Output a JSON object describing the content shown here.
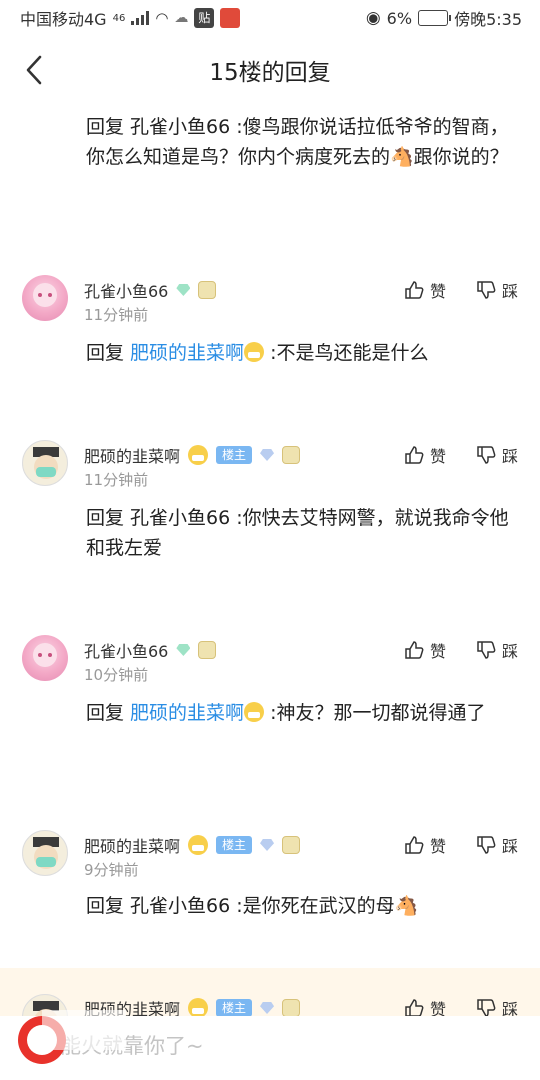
{
  "status": {
    "carrier": "中国移动4G",
    "net": "46",
    "battery": "6%",
    "time": "傍晚5:35",
    "badge1": "贴"
  },
  "nav": {
    "title": "15楼的回复"
  },
  "main_reply": {
    "text": "回复 孔雀小鱼66 :傻鸟跟你说话拉低爷爷的智商，你怎么知道是鸟？你内个病度死去的🐴跟你说的？"
  },
  "comments": [
    {
      "user": "孔雀小鱼66",
      "time": "11分钟前",
      "like": "赞",
      "dislike": "踩",
      "prefix": "回复 ",
      "mention": "肥硕的韭菜啊",
      "text": " :不是鸟还能是什么"
    },
    {
      "user": "肥硕的韭菜啊",
      "owner": "楼主",
      "time": "11分钟前",
      "like": "赞",
      "dislike": "踩",
      "text": "回复 孔雀小鱼66 :你快去艾特网警，就说我命令他和我左爱"
    },
    {
      "user": "孔雀小鱼66",
      "time": "10分钟前",
      "like": "赞",
      "dislike": "踩",
      "prefix": "回复 ",
      "mention": "肥硕的韭菜啊",
      "text": " :神友？那一切都说得通了"
    },
    {
      "user": "肥硕的韭菜啊",
      "owner": "楼主",
      "time": "9分钟前",
      "like": "赞",
      "dislike": "踩",
      "text": "回复 孔雀小鱼66 :是你死在武汉的母🐴"
    },
    {
      "user": "肥硕的韭菜啊",
      "owner": "楼主",
      "like": "赞",
      "dislike": "踩"
    }
  ],
  "input": {
    "placeholder": "能火就靠你了~"
  },
  "colors": {
    "accent": "#2a8de4",
    "owner_tag": "#7ab7f2",
    "highlight_bg": "#fff7ea"
  }
}
